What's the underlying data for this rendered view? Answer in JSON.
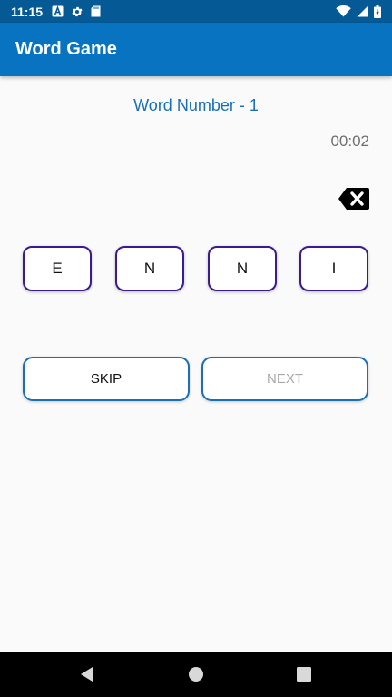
{
  "status_bar": {
    "time": "11:15",
    "left_icons": [
      "a-notification-icon",
      "settings-icon",
      "sd-card-icon"
    ],
    "right_icons": [
      "wifi-icon",
      "signal-icon",
      "battery-charging-icon"
    ]
  },
  "app_bar": {
    "title": "Word Game"
  },
  "game": {
    "word_number": "Word Number - 1",
    "timer": "00:02",
    "tiles": [
      "E",
      "N",
      "N",
      "I"
    ]
  },
  "buttons": {
    "skip": "SKIP",
    "next": "NEXT",
    "next_enabled": false
  },
  "nav_bar": {
    "icons": [
      "back-icon",
      "home-icon",
      "recents-icon"
    ]
  },
  "colors": {
    "status_bar": "#055a96",
    "app_bar": "#0874c1",
    "tile_border": "#3d1a8f",
    "button_border": "#1a6fb8",
    "accent_text": "#1a6fb8"
  }
}
